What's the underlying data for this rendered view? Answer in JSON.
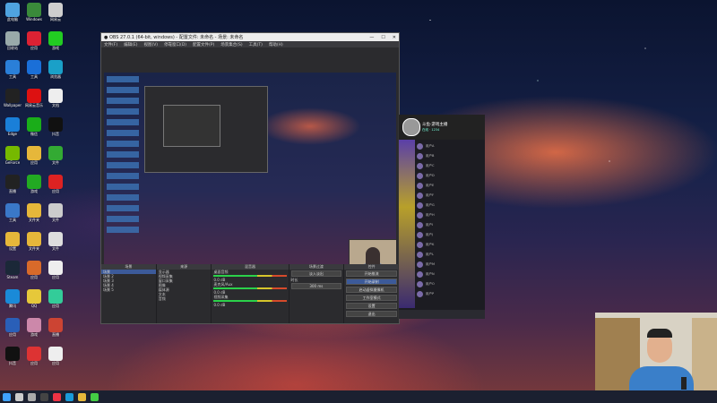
{
  "desktop": {
    "icons": [
      {
        "label": "此电脑",
        "color": "#4fa3e0"
      },
      {
        "label": "Windows",
        "color": "#3a8a3a"
      },
      {
        "label": "网易云",
        "color": "#cfcfcf"
      },
      {
        "label": "回收站",
        "color": "#9aa"
      },
      {
        "label": "应用",
        "color": "#d23"
      },
      {
        "label": "游戏",
        "color": "#2c2"
      },
      {
        "label": "工具",
        "color": "#2a7fd8"
      },
      {
        "label": "工具",
        "color": "#1a6fd8"
      },
      {
        "label": "浏览器",
        "color": "#1aa0c8"
      },
      {
        "label": "Wallpaper",
        "color": "#222"
      },
      {
        "label": "网易云音乐",
        "color": "#d11"
      },
      {
        "label": "文档",
        "color": "#eee"
      },
      {
        "label": "Edge",
        "color": "#1a7fd8"
      },
      {
        "label": "微信",
        "color": "#1aad19"
      },
      {
        "label": "抖音",
        "color": "#111"
      },
      {
        "label": "GeForce",
        "color": "#76b900"
      },
      {
        "label": "应用",
        "color": "#e6b73a"
      },
      {
        "label": "文件",
        "color": "#3a3"
      },
      {
        "label": "直播",
        "color": "#222"
      },
      {
        "label": "游戏",
        "color": "#2a2"
      },
      {
        "label": "应用",
        "color": "#d22"
      },
      {
        "label": "工具",
        "color": "#3a78c8"
      },
      {
        "label": "文件夹",
        "color": "#e6b73a"
      },
      {
        "label": "文件",
        "color": "#ccc"
      },
      {
        "label": "设置",
        "color": "#e6b73a"
      },
      {
        "label": "文件夹",
        "color": "#e6b73a"
      },
      {
        "label": "文件",
        "color": "#ddd"
      },
      {
        "label": "Steam",
        "color": "#1b2838"
      },
      {
        "label": "应用",
        "color": "#d86a2a"
      },
      {
        "label": "应用",
        "color": "#eee"
      },
      {
        "label": "腾讯",
        "color": "#1a8ad8"
      },
      {
        "label": "QQ",
        "color": "#e6c83a"
      },
      {
        "label": "应用",
        "color": "#3c9"
      },
      {
        "label": "应用",
        "color": "#2a5fb8"
      },
      {
        "label": "游戏",
        "color": "#c8a",
        "extra": "#a3a"
      },
      {
        "label": "直播",
        "color": "#c43"
      },
      {
        "label": "抖音",
        "color": "#111"
      },
      {
        "label": "应用",
        "color": "#d33"
      },
      {
        "label": "应用",
        "color": "#eee"
      }
    ]
  },
  "obs": {
    "title": "OBS 27.0.1 (64-bit, windows) - 配置文件: 未命名 - 场景: 未命名",
    "menu": [
      "文件(F)",
      "编辑(E)",
      "视图(V)",
      "停靠窗口(D)",
      "配置文件(P)",
      "场景集合(S)",
      "工具(T)",
      "帮助(H)"
    ],
    "controls": [
      "—",
      "☐",
      "✕"
    ],
    "docks": {
      "scenes": {
        "header": "场景",
        "items": [
          "场景",
          "场景 2",
          "场景 3",
          "场景 4",
          "场景 5"
        ]
      },
      "sources": {
        "header": "来源",
        "items": [
          "显示器",
          "视频采集",
          "窗口采集",
          "图像",
          "媒体源",
          "文本",
          "音频"
        ]
      },
      "mixer": {
        "header": "混音器",
        "labels": [
          "桌面音频",
          "麦克风/Aux",
          "视频采集"
        ],
        "levels": [
          "0.0 dB",
          "0.0 dB",
          "0.0 dB"
        ]
      },
      "transitions": {
        "header": "场景过渡",
        "type": "淡入淡出",
        "duration_label": "时长",
        "duration": "300 ms"
      },
      "controls": {
        "header": "控件",
        "buttons": [
          "开始推流",
          "开始录制",
          "启动虚拟摄像机",
          "工作室模式",
          "设置",
          "退出"
        ]
      }
    }
  },
  "chat": {
    "streamer_name": "斗鱼·游戏主播",
    "subtitle": "在线 · 1234",
    "messages": [
      "用户A",
      "用户B",
      "用户C",
      "用户D",
      "用户E",
      "用户F",
      "用户G",
      "用户H",
      "用户I",
      "用户J",
      "用户K",
      "用户L",
      "用户M",
      "用户N",
      "用户O",
      "用户P"
    ]
  },
  "taskbar": {
    "items": [
      {
        "name": "start-icon",
        "color": "#3fa3ff"
      },
      {
        "name": "search-icon",
        "color": "#ccc"
      },
      {
        "name": "task-view-icon",
        "color": "#aaa"
      },
      {
        "name": "obs-icon",
        "color": "#444"
      },
      {
        "name": "chrome-icon",
        "color": "#e34"
      },
      {
        "name": "edge-icon",
        "color": "#1a9ad8"
      },
      {
        "name": "folder-icon",
        "color": "#e6b73a"
      },
      {
        "name": "app-icon",
        "color": "#4c4"
      }
    ]
  }
}
